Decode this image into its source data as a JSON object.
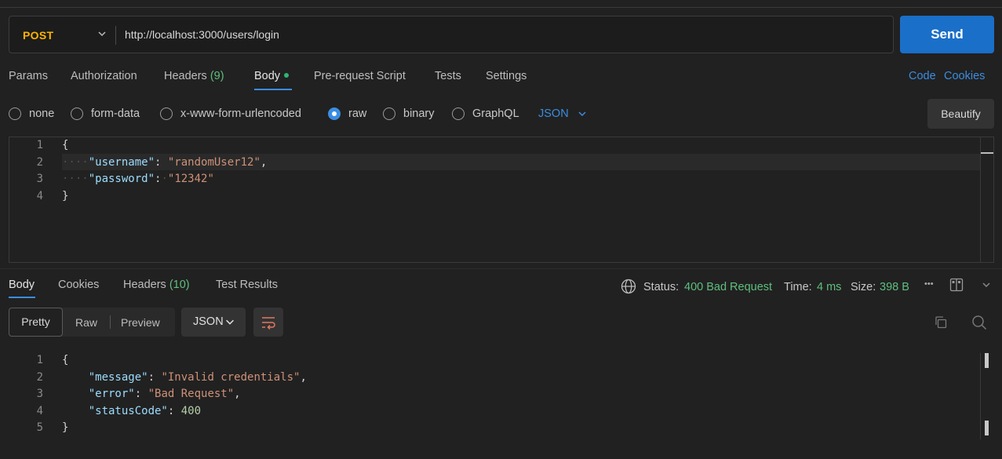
{
  "request": {
    "method": "POST",
    "url": "http://localhost:3000/users/login",
    "send_label": "Send"
  },
  "request_tabs": {
    "params": "Params",
    "authorization": "Authorization",
    "headers": "Headers",
    "headers_count": "(9)",
    "body": "Body",
    "pre_request": "Pre-request Script",
    "tests": "Tests",
    "settings": "Settings",
    "code_link": "Code",
    "cookies_link": "Cookies"
  },
  "body_types": {
    "none": "none",
    "form_data": "form-data",
    "urlencoded": "x-www-form-urlencoded",
    "raw": "raw",
    "binary": "binary",
    "graphql": "GraphQL",
    "selected": "raw",
    "language": "JSON",
    "beautify": "Beautify"
  },
  "request_body": {
    "line_numbers": [
      "1",
      "2",
      "3",
      "4"
    ],
    "lines": {
      "l1": "{",
      "l2_key": "\"username\"",
      "l2_val": "\"randomUser12\"",
      "l3_key": "\"password\"",
      "l3_val": "\"12342\"",
      "l4": "}"
    }
  },
  "response_tabs": {
    "body": "Body",
    "cookies": "Cookies",
    "headers": "Headers",
    "headers_count": "(10)",
    "test_results": "Test Results"
  },
  "response_status": {
    "status_label": "Status:",
    "status_value": "400 Bad Request",
    "time_label": "Time:",
    "time_value": "4 ms",
    "size_label": "Size:",
    "size_value": "398 B",
    "more": "•••"
  },
  "response_view": {
    "pretty": "Pretty",
    "raw": "Raw",
    "preview": "Preview",
    "format": "JSON"
  },
  "response_body": {
    "line_numbers": [
      "1",
      "2",
      "3",
      "4",
      "5"
    ],
    "lines": {
      "l1": "{",
      "l2_key": "\"message\"",
      "l2_val": "\"Invalid credentials\"",
      "l3_key": "\"error\"",
      "l3_val": "\"Bad Request\"",
      "l4_key": "\"statusCode\"",
      "l4_val": "400",
      "l5": "}"
    }
  },
  "colors": {
    "accent": "#3b8de0",
    "method": "#ffb400",
    "send": "#1a6fc8",
    "success_green": "#5fbf7e"
  }
}
